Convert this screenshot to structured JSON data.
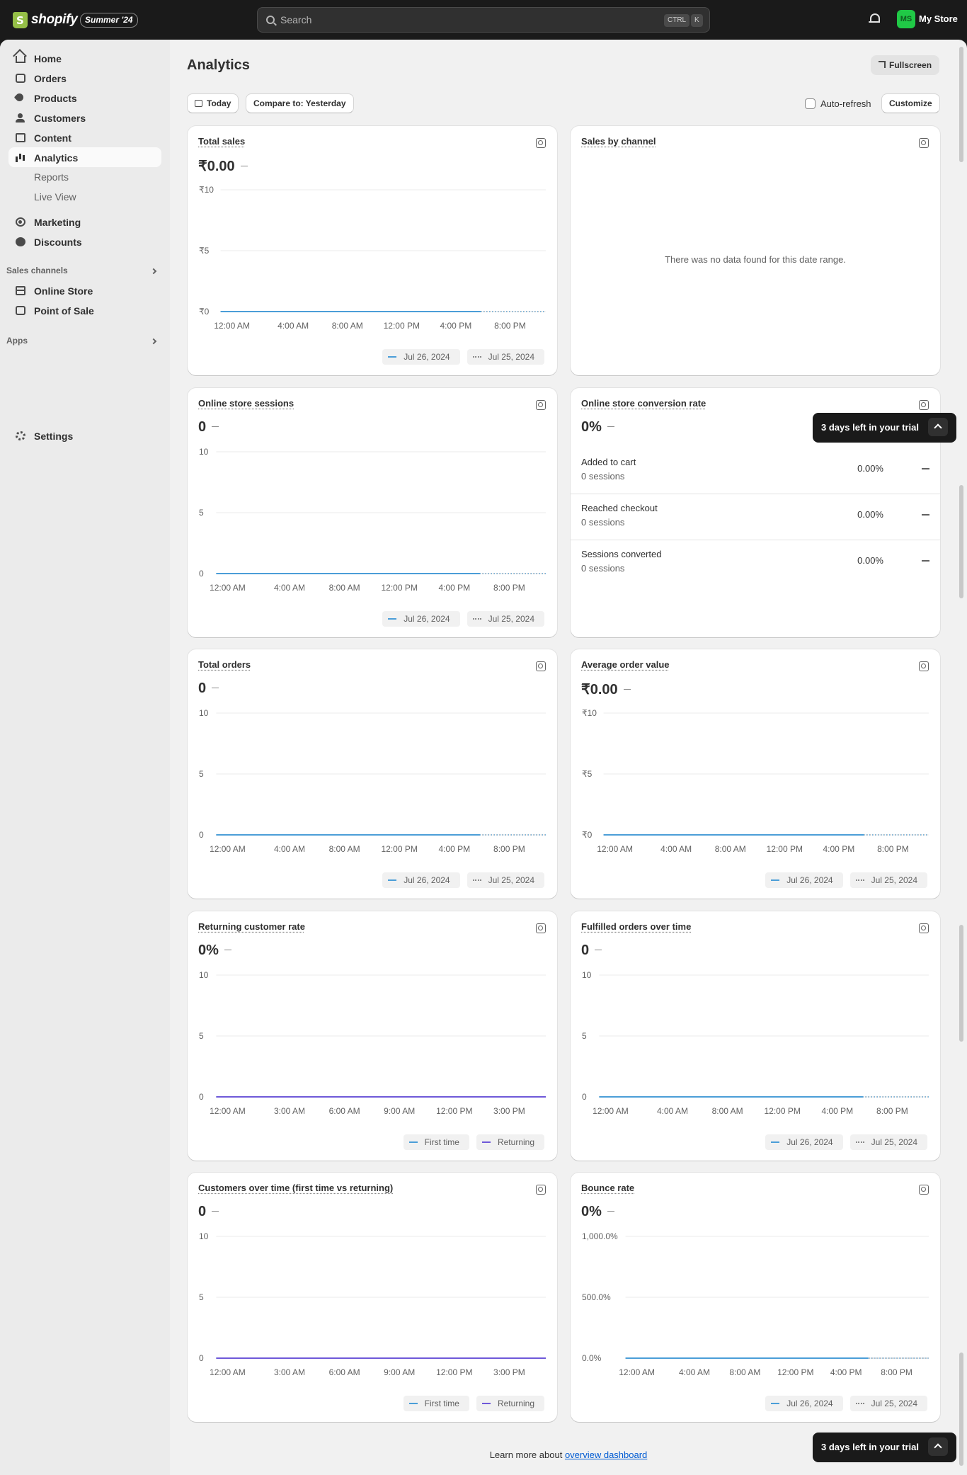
{
  "topbar": {
    "brand": "shopify",
    "edition_badge": "Summer '24",
    "search_placeholder": "Search",
    "shortcut_ctrl": "CTRL",
    "shortcut_key": "K",
    "avatar_initials": "MS",
    "store_name": "My Store"
  },
  "sidebar": {
    "items": [
      {
        "label": "Home",
        "icon": "home-icon"
      },
      {
        "label": "Orders",
        "icon": "inbox-icon"
      },
      {
        "label": "Products",
        "icon": "tag-icon"
      },
      {
        "label": "Customers",
        "icon": "person-icon"
      },
      {
        "label": "Content",
        "icon": "content-icon"
      },
      {
        "label": "Analytics",
        "icon": "analytics-icon",
        "active": true
      },
      {
        "label": "Reports"
      },
      {
        "label": "Live View"
      },
      {
        "label": "Marketing",
        "icon": "target-icon"
      },
      {
        "label": "Discounts",
        "icon": "discount-icon"
      }
    ],
    "sales_channels_heading": "Sales channels",
    "channels": [
      {
        "label": "Online Store",
        "icon": "online-store-icon"
      },
      {
        "label": "Point of Sale",
        "icon": "pos-icon"
      }
    ],
    "apps_heading": "Apps",
    "settings_label": "Settings"
  },
  "header": {
    "title": "Analytics",
    "fullscreen_label": "Fullscreen",
    "date_label": "Today",
    "compare_label": "Compare to: Yesterday",
    "autorefresh_label": "Auto-refresh",
    "customize_label": "Customize"
  },
  "cards": {
    "total_sales": {
      "title": "Total sales",
      "value": "₹0.00"
    },
    "sales_by_channel": {
      "title": "Sales by channel",
      "empty": "There was no data found for this date range."
    },
    "sessions": {
      "title": "Online store sessions",
      "value": "0"
    },
    "conversion": {
      "title": "Online store conversion rate",
      "value": "0%",
      "rows": [
        {
          "name": "Added to cart",
          "sessions": "0 sessions",
          "pct": "0.00%"
        },
        {
          "name": "Reached checkout",
          "sessions": "0 sessions",
          "pct": "0.00%"
        },
        {
          "name": "Sessions converted",
          "sessions": "0 sessions",
          "pct": "0.00%"
        }
      ]
    },
    "total_orders": {
      "title": "Total orders",
      "value": "0"
    },
    "aov": {
      "title": "Average order value",
      "value": "₹0.00"
    },
    "returning_rate": {
      "title": "Returning customer rate",
      "value": "0%"
    },
    "fulfilled": {
      "title": "Fulfilled orders over time",
      "value": "0"
    },
    "customers_over_time": {
      "title": "Customers over time (first time vs returning)",
      "value": "0"
    },
    "bounce": {
      "title": "Bounce rate",
      "value": "0%"
    }
  },
  "legends": {
    "current": "Jul 26, 2024",
    "previous": "Jul 25, 2024",
    "first_time": "First time",
    "returning": "Returning"
  },
  "trial_banner": "3 days left in your trial",
  "footer": {
    "prefix": "Learn more about",
    "link": "overview dashboard"
  },
  "colors": {
    "current": "#4b9ed8",
    "previous": "#8a8a8a",
    "first_time": "#4b9ed8",
    "returning": "#6f59d9",
    "accent": "#005bd3",
    "avatar": "#20c946"
  },
  "chart_data": [
    {
      "id": "total_sales",
      "type": "line",
      "title": "Total sales",
      "yticks": [
        "₹10",
        "₹5",
        "₹0"
      ],
      "ylim": [
        0,
        10
      ],
      "xticks": [
        "12:00 AM",
        "4:00 AM",
        "8:00 AM",
        "12:00 PM",
        "4:00 PM",
        "8:00 PM"
      ],
      "series": [
        {
          "name": "Jul 26, 2024",
          "values": [
            0,
            0
          ]
        },
        {
          "name": "Jul 25, 2024",
          "values": [
            0,
            0
          ]
        }
      ]
    },
    {
      "id": "sessions",
      "type": "line",
      "title": "Online store sessions",
      "yticks": [
        "10",
        "5",
        "0"
      ],
      "ylim": [
        0,
        10
      ],
      "xticks": [
        "12:00 AM",
        "4:00 AM",
        "8:00 AM",
        "12:00 PM",
        "4:00 PM",
        "8:00 PM"
      ],
      "series": [
        {
          "name": "Jul 26, 2024",
          "values": [
            0,
            0
          ]
        },
        {
          "name": "Jul 25, 2024",
          "values": [
            0,
            0
          ]
        }
      ]
    },
    {
      "id": "total_orders",
      "type": "line",
      "title": "Total orders",
      "yticks": [
        "10",
        "5",
        "0"
      ],
      "ylim": [
        0,
        10
      ],
      "xticks": [
        "12:00 AM",
        "4:00 AM",
        "8:00 AM",
        "12:00 PM",
        "4:00 PM",
        "8:00 PM"
      ],
      "series": [
        {
          "name": "Jul 26, 2024",
          "values": [
            0,
            0
          ]
        },
        {
          "name": "Jul 25, 2024",
          "values": [
            0,
            0
          ]
        }
      ]
    },
    {
      "id": "aov",
      "type": "line",
      "title": "Average order value",
      "yticks": [
        "₹10",
        "₹5",
        "₹0"
      ],
      "ylim": [
        0,
        10
      ],
      "xticks": [
        "12:00 AM",
        "4:00 AM",
        "8:00 AM",
        "12:00 PM",
        "4:00 PM",
        "8:00 PM"
      ],
      "series": [
        {
          "name": "Jul 26, 2024",
          "values": [
            0,
            0
          ]
        },
        {
          "name": "Jul 25, 2024",
          "values": [
            0,
            0
          ]
        }
      ]
    },
    {
      "id": "returning_rate",
      "type": "line",
      "title": "Returning customer rate",
      "yticks": [
        "10",
        "5",
        "0"
      ],
      "ylim": [
        0,
        10
      ],
      "xticks": [
        "12:00 AM",
        "3:00 AM",
        "6:00 AM",
        "9:00 AM",
        "12:00 PM",
        "3:00 PM"
      ],
      "series": [
        {
          "name": "First time",
          "values": [
            0,
            0
          ]
        },
        {
          "name": "Returning",
          "values": [
            0,
            0
          ]
        }
      ]
    },
    {
      "id": "fulfilled",
      "type": "line",
      "title": "Fulfilled orders over time",
      "yticks": [
        "10",
        "5",
        "0"
      ],
      "ylim": [
        0,
        10
      ],
      "xticks": [
        "12:00 AM",
        "4:00 AM",
        "8:00 AM",
        "12:00 PM",
        "4:00 PM",
        "8:00 PM"
      ],
      "series": [
        {
          "name": "Jul 26, 2024",
          "values": [
            0,
            0
          ]
        },
        {
          "name": "Jul 25, 2024",
          "values": [
            0,
            0
          ]
        }
      ]
    },
    {
      "id": "customers_over_time",
      "type": "line",
      "title": "Customers over time (first time vs returning)",
      "yticks": [
        "10",
        "5",
        "0"
      ],
      "ylim": [
        0,
        10
      ],
      "xticks": [
        "12:00 AM",
        "3:00 AM",
        "6:00 AM",
        "9:00 AM",
        "12:00 PM",
        "3:00 PM"
      ],
      "series": [
        {
          "name": "First time",
          "values": [
            0,
            0
          ]
        },
        {
          "name": "Returning",
          "values": [
            0,
            0
          ]
        }
      ]
    },
    {
      "id": "bounce",
      "type": "line",
      "title": "Bounce rate",
      "yticks": [
        "1,000.0%",
        "500.0%",
        "0.0%"
      ],
      "ylim": [
        0,
        1000
      ],
      "xticks": [
        "12:00 AM",
        "4:00 AM",
        "8:00 AM",
        "12:00 PM",
        "4:00 PM",
        "8:00 PM"
      ],
      "series": [
        {
          "name": "Jul 26, 2024",
          "values": [
            0,
            0
          ]
        },
        {
          "name": "Jul 25, 2024",
          "values": [
            0,
            0
          ]
        }
      ]
    }
  ]
}
